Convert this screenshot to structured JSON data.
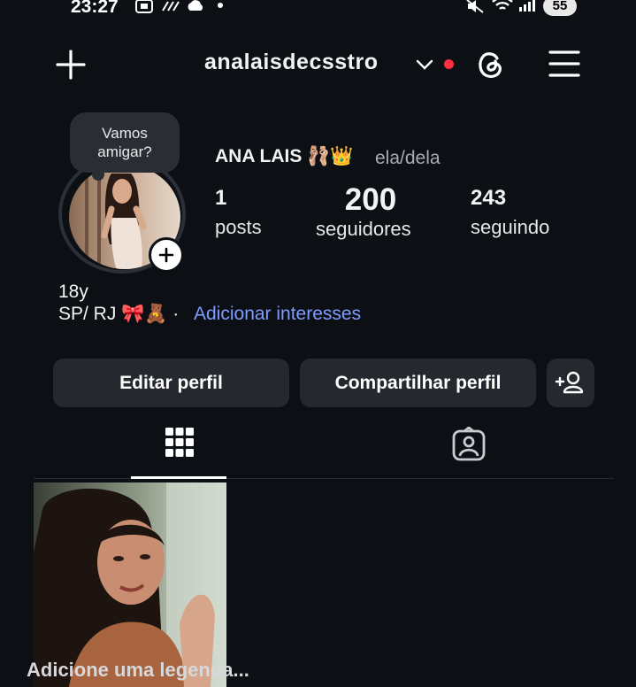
{
  "status_bar": {
    "time": "23:27",
    "battery": "55"
  },
  "header": {
    "username": "analaisdecsstro"
  },
  "note": {
    "text_line1": "Vamos",
    "text_line2": "amigar?"
  },
  "profile": {
    "name": "ANA LAIS 🩰👑",
    "pronouns": "ela/dela",
    "stats": [
      {
        "value": "1",
        "label": "posts"
      },
      {
        "value": "200",
        "label": "seguidores"
      },
      {
        "value": "243",
        "label": "seguindo"
      }
    ],
    "bio_line1": "18y",
    "bio_line2": "SP/ RJ 🎀🧸 ·",
    "add_interests": "Adicionar interesses"
  },
  "actions": {
    "edit_profile": "Editar perfil",
    "share_profile": "Compartilhar perfil"
  },
  "tabs": [
    "grid-icon",
    "tagged-icon"
  ],
  "posts": {
    "caption_hint": "Adicione uma legenda..."
  },
  "colors": {
    "background": "#0c0f14",
    "button": "#25292f",
    "link": "#7f9cff",
    "live_dot": "#ff3040"
  }
}
